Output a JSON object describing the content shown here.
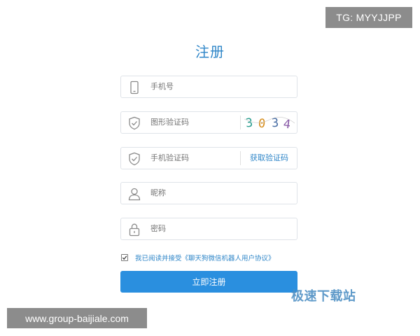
{
  "overlay": {
    "tg_label": "TG: MYYJJPP",
    "site_label": "www.group-baijiale.com",
    "watermark": "极速下载站"
  },
  "form": {
    "title": "注册",
    "phone": {
      "placeholder": "手机号",
      "icon": "phone-icon"
    },
    "captcha": {
      "placeholder": "图形验证码",
      "icon": "shield-check-icon",
      "code": "3034"
    },
    "sms": {
      "placeholder": "手机验证码",
      "icon": "shield-check-icon",
      "get_code_label": "获取验证码"
    },
    "nickname": {
      "placeholder": "昵称",
      "icon": "user-icon"
    },
    "password": {
      "placeholder": "密码",
      "icon": "lock-icon"
    },
    "agreement": {
      "checked": true,
      "text": "我已阅读并接受《聊天狗微信机器人用户协议》"
    },
    "submit_label": "立即注册"
  },
  "colors": {
    "accent": "#2f86c8",
    "button": "#2a8fdf",
    "border": "#dfe3e8",
    "icon": "#8a8a8a",
    "badge_bg": "#8c8c8c"
  }
}
